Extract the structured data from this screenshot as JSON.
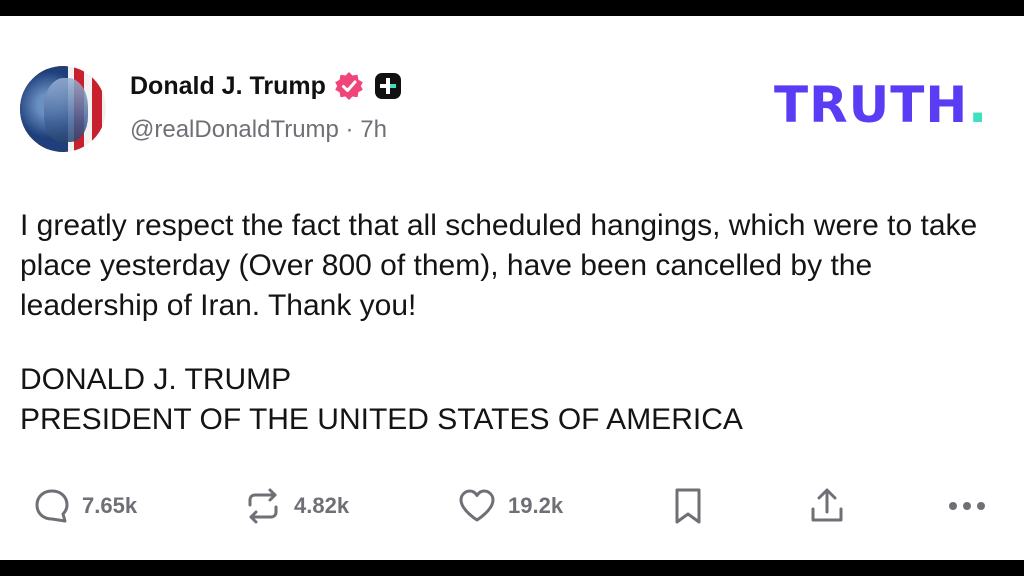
{
  "post": {
    "author_name": "Donald J. Trump",
    "handle_time": "@realDonaldTrump · 7h",
    "brand": "TRUTH",
    "brand_dot": ".",
    "text": "I greatly respect the fact that all scheduled hangings, which were to take place yesterday (Over 800 of them), have been cancelled by the leadership of Iran. Thank you!",
    "signature_line1": "DONALD J. TRUMP",
    "signature_line2": "PRESIDENT OF THE UNITED STATES OF AMERICA"
  },
  "actions": {
    "reply_count": "7.65k",
    "repost_count": "4.82k",
    "like_count": "19.2k"
  },
  "colors": {
    "brand": "#5b3cf5",
    "brand_dot": "#3fe0c0",
    "verified": "#f0457a",
    "icon_gray": "#6f6f76"
  },
  "icons": [
    "verified-badge-icon",
    "plus-badge-icon",
    "reply-icon",
    "repost-icon",
    "like-icon",
    "bookmark-icon",
    "share-icon",
    "more-icon"
  ]
}
